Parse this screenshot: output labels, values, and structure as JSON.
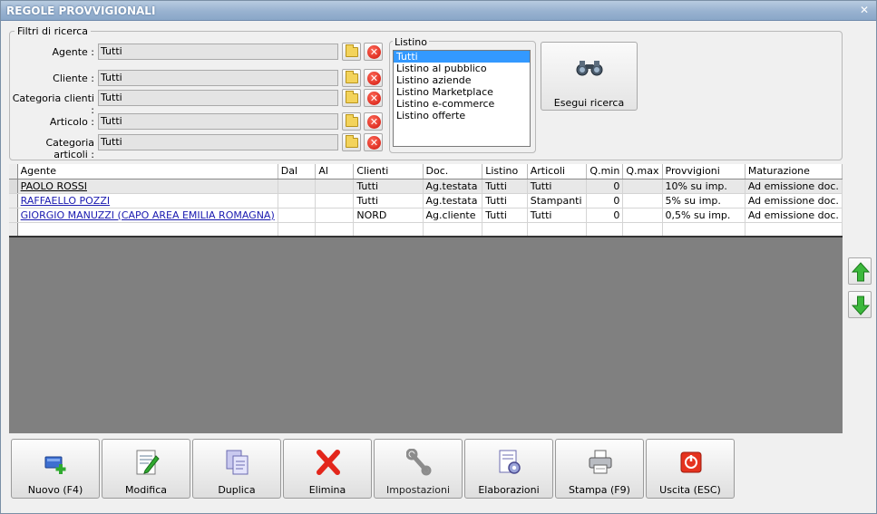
{
  "window": {
    "title": "REGOLE PROVVIGIONALI",
    "close_glyph": "✕"
  },
  "filters": {
    "title": "Filtri di ricerca",
    "rows": [
      {
        "label": "Agente :",
        "value": "Tutti"
      },
      {
        "label": "Cliente :",
        "value": "Tutti"
      },
      {
        "label": "Categoria clienti :",
        "value": "Tutti"
      },
      {
        "label": "Articolo :",
        "value": "Tutti"
      },
      {
        "label": "Categoria articoli :",
        "value": "Tutti"
      }
    ]
  },
  "listino": {
    "title": "Listino",
    "items": [
      "Tutti",
      "Listino al pubblico",
      "Listino aziende",
      "Listino Marketplace",
      "Listino e-commerce",
      "Listino offerte"
    ],
    "selected": "Tutti"
  },
  "search_button": {
    "label": "Esegui ricerca",
    "icon": "binoculars-icon"
  },
  "grid": {
    "columns": [
      "Agente",
      "Dal",
      "Al",
      "Clienti",
      "Doc.",
      "Listino",
      "Articoli",
      "Q.min",
      "Q.max",
      "Provvigioni",
      "Maturazione"
    ],
    "rows": [
      [
        "PAOLO ROSSI",
        "",
        "",
        "Tutti",
        "Ag.testata",
        "Tutti",
        "Tutti",
        "0",
        "",
        "10% su imp.",
        "Ad emissione doc."
      ],
      [
        "RAFFAELLO POZZI",
        "",
        "",
        "Tutti",
        "Ag.testata",
        "Tutti",
        "Stampanti",
        "0",
        "",
        "5% su imp.",
        "Ad emissione doc."
      ],
      [
        "GIORGIO MANUZZI (CAPO AREA EMILIA ROMAGNA)",
        "",
        "",
        "NORD",
        "Ag.cliente",
        "Tutti",
        "Tutti",
        "0",
        "",
        "0,5% su imp.",
        "Ad emissione doc."
      ],
      [
        "",
        "",
        "",
        "",
        "",
        "",
        "",
        "",
        "",
        "",
        ""
      ]
    ]
  },
  "toolbar": [
    {
      "label": "Nuovo (F4)",
      "icon": "new-record-icon"
    },
    {
      "label": "Modifica",
      "icon": "edit-icon"
    },
    {
      "label": "Duplica",
      "icon": "duplicate-icon"
    },
    {
      "label": "Elimina",
      "icon": "delete-icon"
    },
    {
      "label": "Impostazioni",
      "icon": "wrench-icon"
    },
    {
      "label": "Elaborazioni",
      "icon": "process-icon"
    },
    {
      "label": "Stampa (F9)",
      "icon": "printer-icon"
    },
    {
      "label": "Uscita (ESC)",
      "icon": "exit-icon"
    }
  ],
  "colors": {
    "title_bar": "#98b2d0",
    "selected_list": "#3399ff",
    "grid_background": "#808080",
    "arrow_green": "#3cb83c"
  }
}
